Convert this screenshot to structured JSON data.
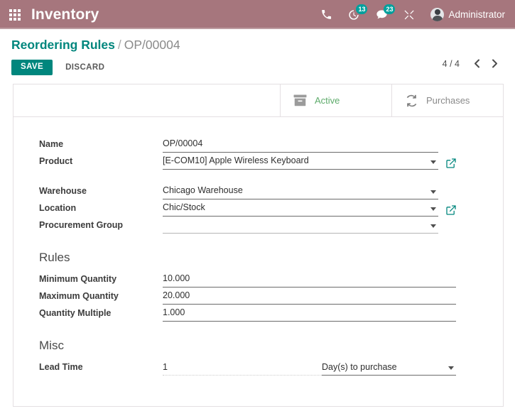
{
  "navbar": {
    "apps_icon": "apps-grid-icon",
    "app_name": "Inventory",
    "icons": [
      {
        "name": "phone-icon",
        "badge": null
      },
      {
        "name": "activity-clock-icon",
        "badge": "13"
      },
      {
        "name": "messages-chat-icon",
        "badge": "23"
      },
      {
        "name": "tools-icon",
        "badge": null
      }
    ],
    "user_name": "Administrator",
    "avatar_icon": "avatar",
    "bg_color": "#a6767d",
    "badge_color": "#00a09d"
  },
  "control_panel": {
    "breadcrumb_root": "Reordering Rules",
    "breadcrumb_separator": "/",
    "breadcrumb_current": "OP/00004",
    "save_label": "SAVE",
    "discard_label": "DISCARD",
    "pager_count": "4 / 4",
    "prev_icon": "chevron-left-icon",
    "next_icon": "chevron-right-icon",
    "accent_color": "#00867d"
  },
  "stat_buttons": [
    {
      "icon": "archive-box-icon",
      "label": "Active",
      "color": "#5eab6b"
    },
    {
      "icon": "refresh-cycle-icon",
      "label": "Purchases",
      "color": "#8a8a8a"
    }
  ],
  "form": {
    "group_main": [
      {
        "label": "Name",
        "value": "OP/00004",
        "type": "text",
        "dropdown": false,
        "external_link": false
      },
      {
        "label": "Product",
        "value": "[E-COM10] Apple Wireless Keyboard",
        "type": "many2one",
        "dropdown": true,
        "external_link": true
      }
    ],
    "group_location": [
      {
        "label": "Warehouse",
        "value": "Chicago Warehouse",
        "type": "many2one",
        "dropdown": true,
        "external_link": false
      },
      {
        "label": "Location",
        "value": "Chic/Stock",
        "type": "many2one",
        "dropdown": true,
        "external_link": true
      },
      {
        "label": "Procurement Group",
        "value": "",
        "type": "many2one",
        "dropdown": true,
        "external_link": false
      }
    ],
    "rules_section": {
      "title": "Rules",
      "fields": [
        {
          "label": "Minimum Quantity",
          "value": "10.000"
        },
        {
          "label": "Maximum Quantity",
          "value": "20.000"
        },
        {
          "label": "Quantity Multiple",
          "value": "1.000"
        }
      ]
    },
    "misc_section": {
      "title": "Misc",
      "lead_time": {
        "label": "Lead Time",
        "quantity": "1",
        "unit": "Day(s) to purchase"
      }
    }
  }
}
